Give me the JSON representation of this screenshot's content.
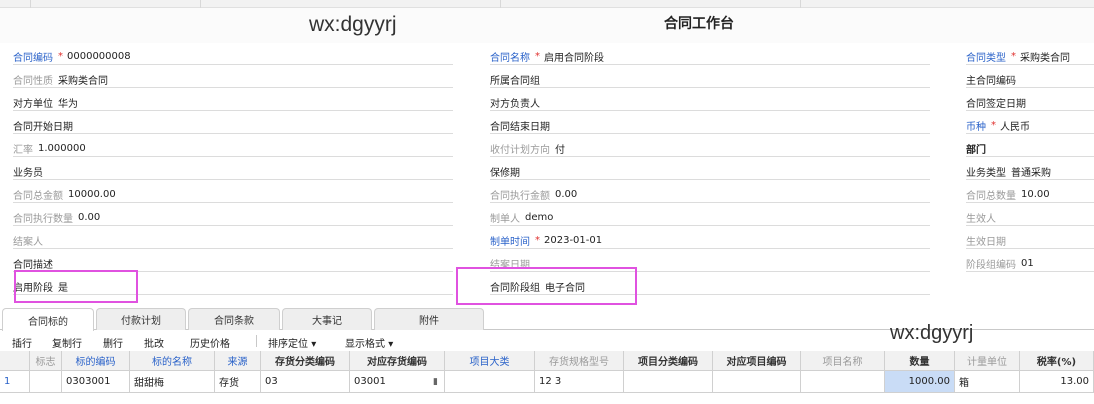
{
  "header": {
    "watermark": "wx:dgyyrj",
    "title": "合同工作台"
  },
  "form": {
    "contract_code": {
      "label": "合同编码",
      "value": "0000000008"
    },
    "contract_name": {
      "label": "合同名称",
      "value": "启用合同阶段"
    },
    "contract_type": {
      "label": "合同类型",
      "value": "采购类合同"
    },
    "contract_nature": {
      "label": "合同性质",
      "value": "采购类合同"
    },
    "group": {
      "label": "所属合同组",
      "value": ""
    },
    "main_contract_code": {
      "label": "主合同编码",
      "value": ""
    },
    "counterparty": {
      "label": "对方单位",
      "value": "华为"
    },
    "counterparty_person": {
      "label": "对方负责人",
      "value": ""
    },
    "sign_date": {
      "label": "合同签定日期",
      "value": ""
    },
    "start_date": {
      "label": "合同开始日期",
      "value": ""
    },
    "end_date": {
      "label": "合同结束日期",
      "value": ""
    },
    "currency": {
      "label": "币种",
      "value": "人民币"
    },
    "exchange_rate": {
      "label": "汇率",
      "value": "1.000000"
    },
    "payment_direction": {
      "label": "收付计划方向",
      "value": "付"
    },
    "department": {
      "label": "部门",
      "value": ""
    },
    "salesman": {
      "label": "业务员",
      "value": ""
    },
    "warranty": {
      "label": "保修期",
      "value": ""
    },
    "business_type": {
      "label": "业务类型",
      "value": "普通采购"
    },
    "total_amount": {
      "label": "合同总金额",
      "value": "10000.00"
    },
    "executed_amount": {
      "label": "合同执行金额",
      "value": "0.00"
    },
    "total_quantity": {
      "label": "合同总数量",
      "value": "10.00"
    },
    "executed_quantity": {
      "label": "合同执行数量",
      "value": "0.00"
    },
    "creator": {
      "label": "制单人",
      "value": "demo"
    },
    "effective_person": {
      "label": "生效人",
      "value": ""
    },
    "closer": {
      "label": "结案人",
      "value": ""
    },
    "create_time": {
      "label": "制单时间",
      "value": "2023-01-01"
    },
    "effective_date": {
      "label": "生效日期",
      "value": ""
    },
    "description": {
      "label": "合同描述",
      "value": ""
    },
    "close_date": {
      "label": "结案日期",
      "value": ""
    },
    "stage_group_code": {
      "label": "阶段组编码",
      "value": "01"
    },
    "enable_stage": {
      "label": "启用阶段",
      "value": "是"
    },
    "stage_group": {
      "label": "合同阶段组",
      "value": "电子合同"
    }
  },
  "tabs": [
    {
      "label": "合同标的"
    },
    {
      "label": "付款计划"
    },
    {
      "label": "合同条款"
    },
    {
      "label": "大事记"
    },
    {
      "label": "附件"
    }
  ],
  "toolbar": {
    "insert": "插行",
    "copy_row": "复制行",
    "delete_row": "删行",
    "batch_edit": "批改",
    "history_price": "历史价格",
    "sort": "排序定位",
    "display_format": "显示格式"
  },
  "grid": {
    "headers": [
      "",
      "标志",
      "标的编码",
      "标的名称",
      "来源",
      "存货分类编码",
      "对应存货编码",
      "项目大类",
      "存货规格型号",
      "项目分类编码",
      "对应项目编码",
      "项目名称",
      "数量",
      "计量单位",
      "税率(%)"
    ],
    "rows": [
      [
        "1",
        "",
        "0303001",
        "甜甜梅",
        "存货",
        "03",
        "03001",
        "",
        "12 3",
        "",
        "",
        "",
        "1000.00",
        "箱",
        "13.00"
      ]
    ]
  }
}
